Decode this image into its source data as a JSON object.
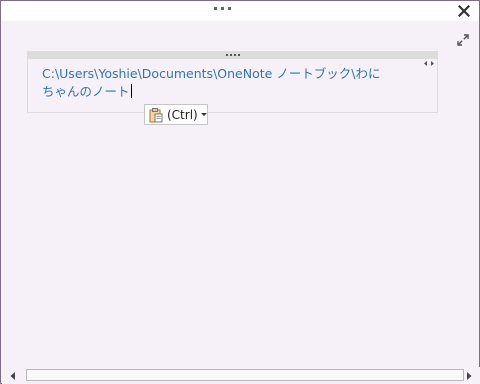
{
  "note": {
    "text_line1": "C:\\Users\\Yoshie\\Documents\\OneNote ノートブック\\わに",
    "text_line2": "ちゃんのノート"
  },
  "paste_options": {
    "label": "(Ctrl)"
  },
  "icons": {
    "close": "close-icon",
    "expand": "expand-icon",
    "clipboard": "clipboard-icon",
    "grip": "grip-dots-icon",
    "scroll_left": "arrow-left-icon",
    "scroll_right": "arrow-right-icon"
  },
  "colors": {
    "note_text": "#2e75b6",
    "background": "#f6f0f8",
    "window_border": "#7b6e86"
  }
}
